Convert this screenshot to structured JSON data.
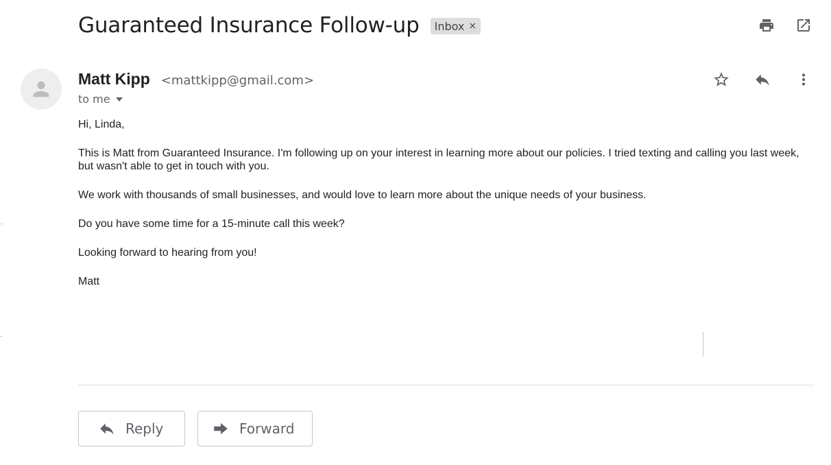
{
  "subject": "Guaranteed Insurance Follow-up",
  "label_chip": {
    "text": "Inbox",
    "close": "×"
  },
  "toolbar": {
    "print_icon": "print-icon",
    "open_new_window_icon": "open-in-new-icon"
  },
  "sender": {
    "name": "Matt Kipp",
    "email": "<mattkipp@gmail.com>"
  },
  "recipient_line": "to me",
  "message_actions": {
    "star_icon": "star-icon",
    "reply_icon": "reply-icon",
    "more_icon": "more-vert-icon"
  },
  "body_paragraphs": [
    "Hi, Linda,",
    "This is Matt from Guaranteed Insurance. I'm following up on your interest in learning more about our policies. I tried texting and calling you last week, but wasn't able to get in touch with you.",
    "We work with thousands of small businesses, and would love to learn more about the unique needs of your business.",
    "Do you have some time for a 15-minute call this week?",
    "Looking forward to hearing from you!",
    "Matt"
  ],
  "actions": {
    "reply_label": "Reply",
    "forward_label": "Forward"
  },
  "colors": {
    "text": "#202124",
    "secondary": "#5f6368",
    "chip_bg": "#dddddd",
    "border": "#c6c6c6"
  }
}
